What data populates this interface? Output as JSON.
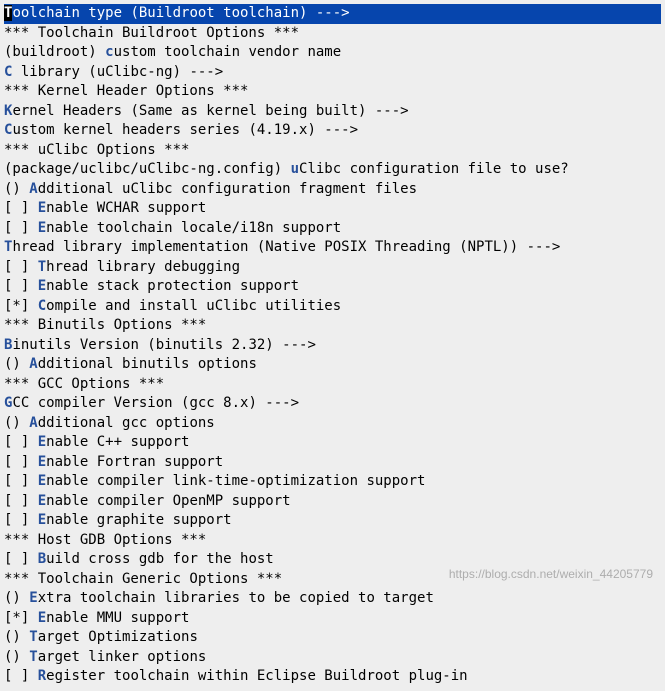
{
  "lines": [
    {
      "prefix": "    ",
      "mark": "",
      "hot": "T",
      "rest": "oolchain type (Buildroot toolchain)  --->",
      "hl": true
    },
    {
      "prefix": "    ",
      "mark": "",
      "hot": "",
      "rest": "*** Toolchain Buildroot Options ***"
    },
    {
      "prefix": "",
      "mark": "(buildroot) ",
      "hot": "c",
      "rest": "ustom toolchain vendor name"
    },
    {
      "prefix": "    ",
      "mark": "",
      "hot": "C",
      "rest": " library (uClibc-ng)  --->"
    },
    {
      "prefix": "    ",
      "mark": "",
      "hot": "",
      "rest": "*** Kernel Header Options ***"
    },
    {
      "prefix": "    ",
      "mark": "",
      "hot": "K",
      "rest": "ernel Headers (Same as kernel being built)  --->"
    },
    {
      "prefix": "    ",
      "mark": "",
      "hot": "C",
      "rest": "ustom kernel headers series (4.19.x)  --->"
    },
    {
      "prefix": "    ",
      "mark": "",
      "hot": "",
      "rest": "*** uClibc Options ***"
    },
    {
      "prefix": "",
      "mark": "(package/uclibc/uClibc-ng.config) ",
      "hot": "u",
      "rest": "Clibc configuration file to use?"
    },
    {
      "prefix": "",
      "mark": "()  ",
      "hot": "A",
      "rest": "dditional uClibc configuration fragment files"
    },
    {
      "prefix": "",
      "mark": "[ ] ",
      "hot": "E",
      "rest": "nable WCHAR support"
    },
    {
      "prefix": "",
      "mark": "[ ] ",
      "hot": "E",
      "rest": "nable toolchain locale/i18n support"
    },
    {
      "prefix": "    ",
      "mark": "",
      "hot": "T",
      "rest": "hread library implementation (Native POSIX Threading (NPTL))  --->"
    },
    {
      "prefix": "",
      "mark": "[ ] ",
      "hot": "T",
      "rest": "hread library debugging"
    },
    {
      "prefix": "",
      "mark": "[ ] ",
      "hot": "E",
      "rest": "nable stack protection support"
    },
    {
      "prefix": "",
      "mark": "[*] ",
      "hot": "C",
      "rest": "ompile and install uClibc utilities"
    },
    {
      "prefix": "    ",
      "mark": "",
      "hot": "",
      "rest": "*** Binutils Options ***"
    },
    {
      "prefix": "    ",
      "mark": "",
      "hot": "B",
      "rest": "inutils Version (binutils 2.32)  --->"
    },
    {
      "prefix": "",
      "mark": "()  ",
      "hot": "A",
      "rest": "dditional binutils options"
    },
    {
      "prefix": "    ",
      "mark": "",
      "hot": "",
      "rest": "*** GCC Options ***"
    },
    {
      "prefix": "    ",
      "mark": "",
      "hot": "G",
      "rest": "CC compiler Version (gcc 8.x)  --->"
    },
    {
      "prefix": "",
      "mark": "()  ",
      "hot": "A",
      "rest": "dditional gcc options"
    },
    {
      "prefix": "",
      "mark": "[ ] ",
      "hot": "E",
      "rest": "nable C++ support"
    },
    {
      "prefix": "",
      "mark": "[ ] ",
      "hot": "E",
      "rest": "nable Fortran support"
    },
    {
      "prefix": "",
      "mark": "[ ] ",
      "hot": "E",
      "rest": "nable compiler link-time-optimization support"
    },
    {
      "prefix": "",
      "mark": "[ ] ",
      "hot": "E",
      "rest": "nable compiler OpenMP support"
    },
    {
      "prefix": "",
      "mark": "[ ] ",
      "hot": "E",
      "rest": "nable graphite support"
    },
    {
      "prefix": "    ",
      "mark": "",
      "hot": "",
      "rest": "*** Host GDB Options ***"
    },
    {
      "prefix": "",
      "mark": "[ ] ",
      "hot": "B",
      "rest": "uild cross gdb for the host"
    },
    {
      "prefix": "    ",
      "mark": "",
      "hot": "",
      "rest": "*** Toolchain Generic Options ***"
    },
    {
      "prefix": "",
      "mark": "()  ",
      "hot": "E",
      "rest": "xtra toolchain libraries to be copied to target"
    },
    {
      "prefix": "",
      "mark": "[*] ",
      "hot": "E",
      "rest": "nable MMU support"
    },
    {
      "prefix": "",
      "mark": "()  ",
      "hot": "T",
      "rest": "arget Optimizations"
    },
    {
      "prefix": "",
      "mark": "()  ",
      "hot": "T",
      "rest": "arget linker options"
    },
    {
      "prefix": "",
      "mark": "[ ] ",
      "hot": "R",
      "rest": "egister toolchain within Eclipse Buildroot plug-in"
    }
  ],
  "watermark": "https://blog.csdn.net/weixin_44205779"
}
